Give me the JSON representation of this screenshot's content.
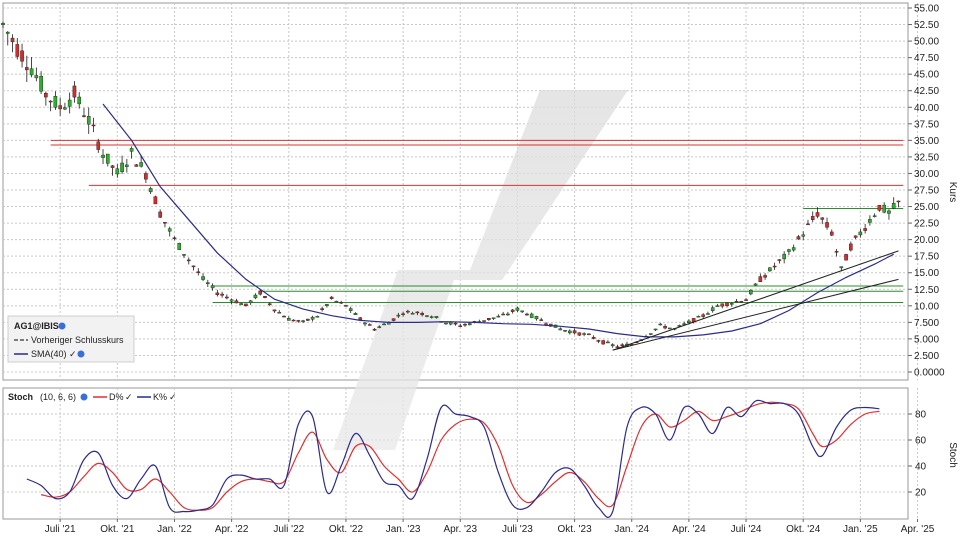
{
  "chart_data": [
    {
      "type": "candlestick",
      "symbol": "AG1@IBIS",
      "ylabel": "Kurs",
      "ylim": [
        0,
        55
      ],
      "yticks": [
        "0.0000",
        "2.500",
        "5.000",
        "7.500",
        "10.00",
        "12.50",
        "15.00",
        "17.50",
        "20.00",
        "22.50",
        "25.00",
        "27.50",
        "30.00",
        "32.50",
        "35.00",
        "37.50",
        "40.00",
        "42.50",
        "45.00",
        "47.50",
        "50.00",
        "52.50",
        "55.00"
      ],
      "xticks": [
        "Juli '21",
        "Okt. '21",
        "Jan. '22",
        "Apr. '22",
        "Juli '22",
        "Okt. '22",
        "Jan. '23",
        "Apr. '23",
        "Juli '23",
        "Okt. '23",
        "Jan. '24",
        "Apr. '24",
        "Juli '24",
        "Okt. '24",
        "Jan. '25",
        "Apr. '25"
      ],
      "legend": [
        {
          "label": "AG1@IBIS",
          "style": "bold"
        },
        {
          "label": "Vorheriger Schlusskurs",
          "style": "dash",
          "color": "#333333"
        },
        {
          "label": "SMA(40)",
          "style": "line",
          "color": "#2b2b8c"
        }
      ],
      "price_path": [
        [
          0,
          52.5
        ],
        [
          3,
          49
        ],
        [
          6,
          46
        ],
        [
          9,
          42
        ],
        [
          12,
          40
        ],
        [
          15,
          42
        ],
        [
          18,
          38
        ],
        [
          21,
          33
        ],
        [
          24,
          30
        ],
        [
          27,
          33
        ],
        [
          30,
          30
        ],
        [
          33,
          24
        ],
        [
          36,
          20
        ],
        [
          39,
          17
        ],
        [
          42,
          14
        ],
        [
          45,
          12
        ],
        [
          48,
          11
        ],
        [
          51,
          10
        ],
        [
          54,
          12
        ],
        [
          57,
          9.5
        ],
        [
          60,
          8
        ],
        [
          63,
          7.5
        ],
        [
          66,
          8.5
        ],
        [
          69,
          11
        ],
        [
          72,
          10
        ],
        [
          75,
          8
        ],
        [
          78,
          6.5
        ],
        [
          81,
          7.5
        ],
        [
          84,
          9
        ],
        [
          87,
          9
        ],
        [
          90,
          8.5
        ],
        [
          93,
          7.5
        ],
        [
          96,
          7
        ],
        [
          99,
          7.5
        ],
        [
          102,
          8
        ],
        [
          105,
          8.5
        ],
        [
          108,
          9.5
        ],
        [
          111,
          8.5
        ],
        [
          114,
          7.5
        ],
        [
          117,
          6.5
        ],
        [
          120,
          6
        ],
        [
          123,
          5.5
        ],
        [
          126,
          4.5
        ],
        [
          129,
          3.8
        ],
        [
          132,
          4.2
        ],
        [
          135,
          5.5
        ],
        [
          138,
          7
        ],
        [
          141,
          6.5
        ],
        [
          144,
          7.5
        ],
        [
          147,
          8.5
        ],
        [
          150,
          10
        ],
        [
          153,
          10.5
        ],
        [
          156,
          11
        ],
        [
          159,
          14
        ],
        [
          162,
          16
        ],
        [
          165,
          18
        ],
        [
          168,
          21
        ],
        [
          171,
          24
        ],
        [
          174,
          21
        ],
        [
          176,
          15.5
        ],
        [
          178,
          19
        ],
        [
          181,
          22
        ],
        [
          184,
          25
        ],
        [
          186,
          24
        ],
        [
          188,
          25.5
        ]
      ],
      "sma40": [
        [
          21,
          40.5
        ],
        [
          27,
          35
        ],
        [
          33,
          28
        ],
        [
          39,
          23
        ],
        [
          45,
          18
        ],
        [
          51,
          14
        ],
        [
          57,
          11
        ],
        [
          63,
          9.5
        ],
        [
          69,
          8.5
        ],
        [
          75,
          7.8
        ],
        [
          81,
          7.5
        ],
        [
          87,
          7.5
        ],
        [
          93,
          7.6
        ],
        [
          99,
          7.5
        ],
        [
          105,
          7.3
        ],
        [
          111,
          7.2
        ],
        [
          117,
          6.9
        ],
        [
          123,
          6.5
        ],
        [
          129,
          5.8
        ],
        [
          135,
          5.3
        ],
        [
          141,
          5.3
        ],
        [
          147,
          5.6
        ],
        [
          153,
          6.2
        ],
        [
          159,
          7.3
        ],
        [
          165,
          9.3
        ],
        [
          171,
          12.0
        ],
        [
          177,
          14.3
        ],
        [
          183,
          16.3
        ],
        [
          187,
          17.8
        ]
      ],
      "horizontal_levels": [
        {
          "y": 35.0,
          "x_from": 10,
          "x_to": 189,
          "color": "#e03030"
        },
        {
          "y": 34.3,
          "x_from": 10,
          "x_to": 189,
          "color": "#e03030"
        },
        {
          "y": 28.2,
          "x_from": 18,
          "x_to": 189,
          "color": "#e03030"
        },
        {
          "y": 24.7,
          "x_from": 168,
          "x_to": 189,
          "color": "#2e8b2e"
        },
        {
          "y": 13.0,
          "x_from": 44,
          "x_to": 189,
          "color": "#2e8b2e"
        },
        {
          "y": 12.2,
          "x_from": 54,
          "x_to": 189,
          "color": "#2e8b2e"
        },
        {
          "y": 10.5,
          "x_from": 44,
          "x_to": 189,
          "color": "#2e8b2e"
        }
      ],
      "trend_lines": [
        {
          "from": [
            128,
            3.3
          ],
          "to": [
            188,
            18.3
          ],
          "color": "#222222"
        },
        {
          "from": [
            128,
            3.3
          ],
          "to": [
            188,
            14.0
          ],
          "color": "#222222"
        }
      ]
    },
    {
      "type": "line",
      "title": "Stoch",
      "params": "(10, 6, 6)",
      "ylabel": "Stoch",
      "ylim": [
        0,
        100
      ],
      "yticks": [
        20,
        40,
        60,
        80
      ],
      "series": [
        {
          "name": "K%",
          "color": "#2b2b8c",
          "points": [
            [
              5,
              30
            ],
            [
              8,
              25
            ],
            [
              11,
              15
            ],
            [
              14,
              20
            ],
            [
              17,
              45
            ],
            [
              20,
              50
            ],
            [
              23,
              25
            ],
            [
              26,
              15
            ],
            [
              29,
              30
            ],
            [
              32,
              40
            ],
            [
              35,
              8
            ],
            [
              38,
              5
            ],
            [
              41,
              6
            ],
            [
              44,
              10
            ],
            [
              47,
              30
            ],
            [
              50,
              33
            ],
            [
              53,
              30
            ],
            [
              56,
              30
            ],
            [
              59,
              25
            ],
            [
              62,
              72
            ],
            [
              65,
              78
            ],
            [
              68,
              20
            ],
            [
              71,
              40
            ],
            [
              74,
              65
            ],
            [
              77,
              48
            ],
            [
              80,
              28
            ],
            [
              83,
              25
            ],
            [
              86,
              15
            ],
            [
              89,
              45
            ],
            [
              92,
              85
            ],
            [
              95,
              80
            ],
            [
              98,
              78
            ],
            [
              101,
              70
            ],
            [
              104,
              35
            ],
            [
              107,
              10
            ],
            [
              110,
              8
            ],
            [
              113,
              20
            ],
            [
              116,
              35
            ],
            [
              119,
              38
            ],
            [
              122,
              25
            ],
            [
              125,
              8
            ],
            [
              128,
              5
            ],
            [
              131,
              70
            ],
            [
              134,
              85
            ],
            [
              137,
              80
            ],
            [
              140,
              60
            ],
            [
              143,
              85
            ],
            [
              146,
              80
            ],
            [
              149,
              65
            ],
            [
              152,
              85
            ],
            [
              155,
              78
            ],
            [
              158,
              90
            ],
            [
              161,
              88
            ],
            [
              164,
              88
            ],
            [
              167,
              80
            ],
            [
              170,
              55
            ],
            [
              172,
              48
            ],
            [
              175,
              70
            ],
            [
              178,
              83
            ],
            [
              181,
              85
            ],
            [
              184,
              84
            ]
          ]
        },
        {
          "name": "D%",
          "color": "#e03030",
          "points": [
            [
              8,
              18
            ],
            [
              11,
              16
            ],
            [
              14,
              20
            ],
            [
              17,
              32
            ],
            [
              20,
              42
            ],
            [
              23,
              35
            ],
            [
              26,
              22
            ],
            [
              29,
              22
            ],
            [
              32,
              30
            ],
            [
              35,
              20
            ],
            [
              38,
              8
            ],
            [
              41,
              6
            ],
            [
              44,
              8
            ],
            [
              47,
              20
            ],
            [
              50,
              28
            ],
            [
              53,
              30
            ],
            [
              56,
              28
            ],
            [
              59,
              28
            ],
            [
              62,
              50
            ],
            [
              65,
              66
            ],
            [
              68,
              45
            ],
            [
              71,
              35
            ],
            [
              74,
              55
            ],
            [
              77,
              55
            ],
            [
              80,
              40
            ],
            [
              83,
              30
            ],
            [
              86,
              20
            ],
            [
              89,
              35
            ],
            [
              92,
              60
            ],
            [
              95,
              72
            ],
            [
              98,
              76
            ],
            [
              101,
              73
            ],
            [
              104,
              55
            ],
            [
              107,
              25
            ],
            [
              110,
              12
            ],
            [
              113,
              18
            ],
            [
              116,
              28
            ],
            [
              119,
              35
            ],
            [
              122,
              28
            ],
            [
              125,
              15
            ],
            [
              128,
              10
            ],
            [
              131,
              40
            ],
            [
              134,
              70
            ],
            [
              137,
              80
            ],
            [
              140,
              70
            ],
            [
              143,
              75
            ],
            [
              146,
              82
            ],
            [
              149,
              75
            ],
            [
              152,
              78
            ],
            [
              155,
              82
            ],
            [
              158,
              87
            ],
            [
              161,
              89
            ],
            [
              164,
              88
            ],
            [
              167,
              84
            ],
            [
              170,
              65
            ],
            [
              172,
              55
            ],
            [
              175,
              60
            ],
            [
              178,
              72
            ],
            [
              181,
              80
            ],
            [
              184,
              82
            ]
          ]
        }
      ]
    }
  ]
}
